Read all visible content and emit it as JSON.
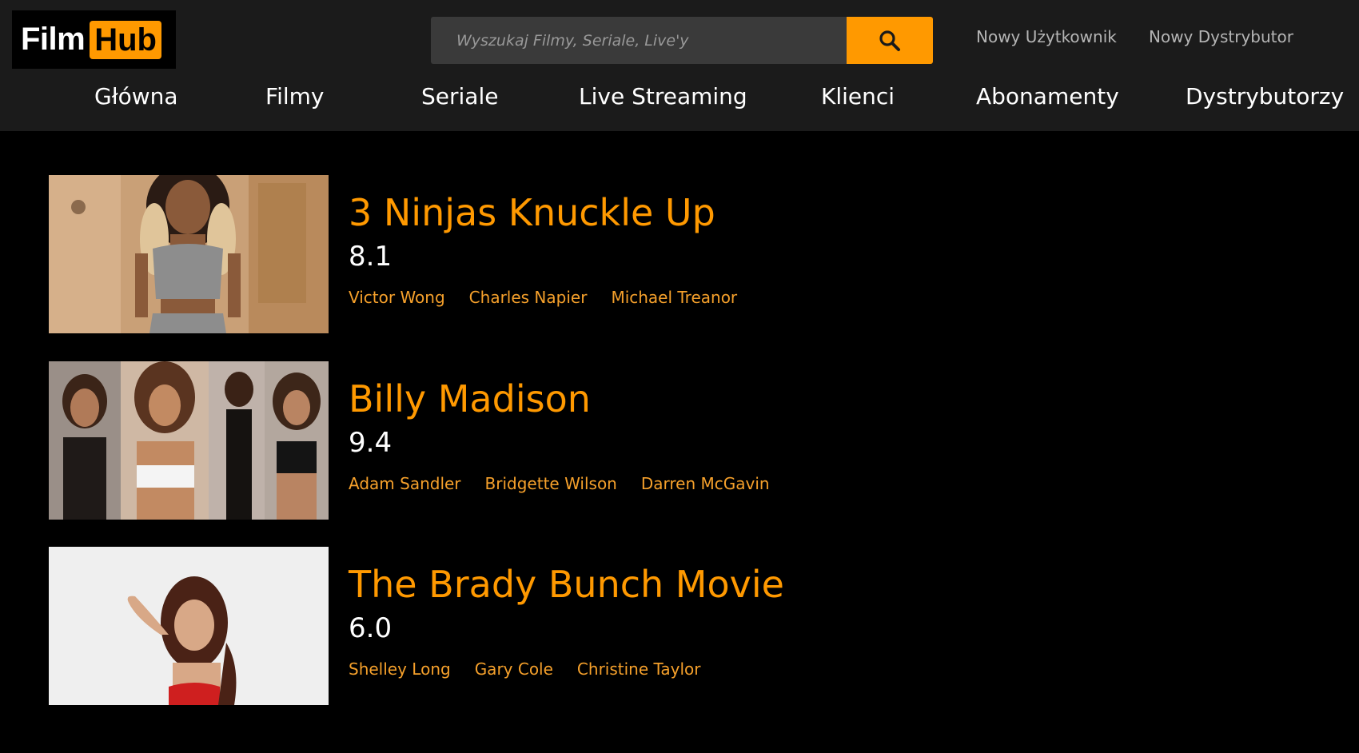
{
  "logo": {
    "part1": "Film",
    "part2": "Hub"
  },
  "search": {
    "placeholder": "Wyszukaj Filmy, Seriale, Live'y",
    "value": ""
  },
  "top_links": {
    "new_user": "Nowy Użytkownik",
    "new_distributor": "Nowy Dystrybutor"
  },
  "nav": [
    {
      "label": "Główna"
    },
    {
      "label": "Filmy"
    },
    {
      "label": "Seriale"
    },
    {
      "label": "Live Streaming"
    },
    {
      "label": "Klienci"
    },
    {
      "label": "Abonamenty"
    },
    {
      "label": "Dystrybutorzy"
    }
  ],
  "movies": [
    {
      "title": "3 Ninjas Knuckle Up",
      "rating": "8.1",
      "cast": [
        "Victor Wong",
        "Charles Napier",
        "Michael Treanor"
      ]
    },
    {
      "title": "Billy Madison",
      "rating": "9.4",
      "cast": [
        "Adam Sandler",
        "Bridgette Wilson",
        "Darren McGavin"
      ]
    },
    {
      "title": "The Brady Bunch Movie",
      "rating": "6.0",
      "cast": [
        "Shelley Long",
        "Gary Cole",
        "Christine Taylor"
      ]
    }
  ],
  "colors": {
    "accent": "#ff9900",
    "header_bg": "#1b1b1b",
    "page_bg": "#000000"
  },
  "icons": {
    "search": "search-icon"
  }
}
